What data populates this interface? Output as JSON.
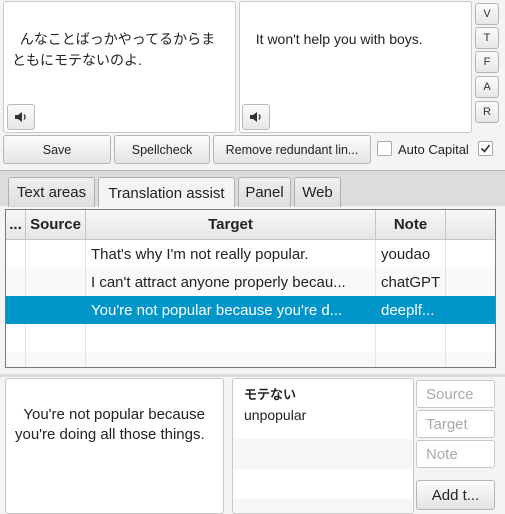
{
  "source_text": "んなことばっかやってるからまともにモテないのよ.",
  "target_text": "It won't help you with boys.",
  "side_buttons": [
    "V",
    "T",
    "F",
    "A",
    "R"
  ],
  "buttons": {
    "save": "Save",
    "spellcheck": "Spellcheck",
    "remove_redundant": "Remove redundant lin...",
    "auto_capital": "Auto Capital"
  },
  "auto_capital_checked": false,
  "extra_checkbox_checked": true,
  "tabs": [
    "Text areas",
    "Translation assist",
    "Panel",
    "Web"
  ],
  "active_tab": "Translation assist",
  "table": {
    "columns": [
      "...",
      "Source",
      "Target",
      "Note"
    ],
    "rows": [
      {
        "source": "",
        "target": "That's why I'm not really popular.",
        "note": "youdao"
      },
      {
        "source": "",
        "target": "I can't attract anyone properly becau...",
        "note": "chatGPT"
      },
      {
        "source": "",
        "target": "You're not popular because you're d...",
        "note": "deeplf..."
      }
    ],
    "selected_row": 2
  },
  "detail_text": "You're not popular because you're doing all those things.",
  "glossary": {
    "term": "モテない",
    "meaning": "unpopular"
  },
  "glossary_fields": {
    "source_placeholder": "Source",
    "target_placeholder": "Target",
    "note_placeholder": "Note",
    "add_button": "Add t..."
  },
  "icons": {
    "speaker": "speaker-icon",
    "check": "checkmark-icon"
  }
}
